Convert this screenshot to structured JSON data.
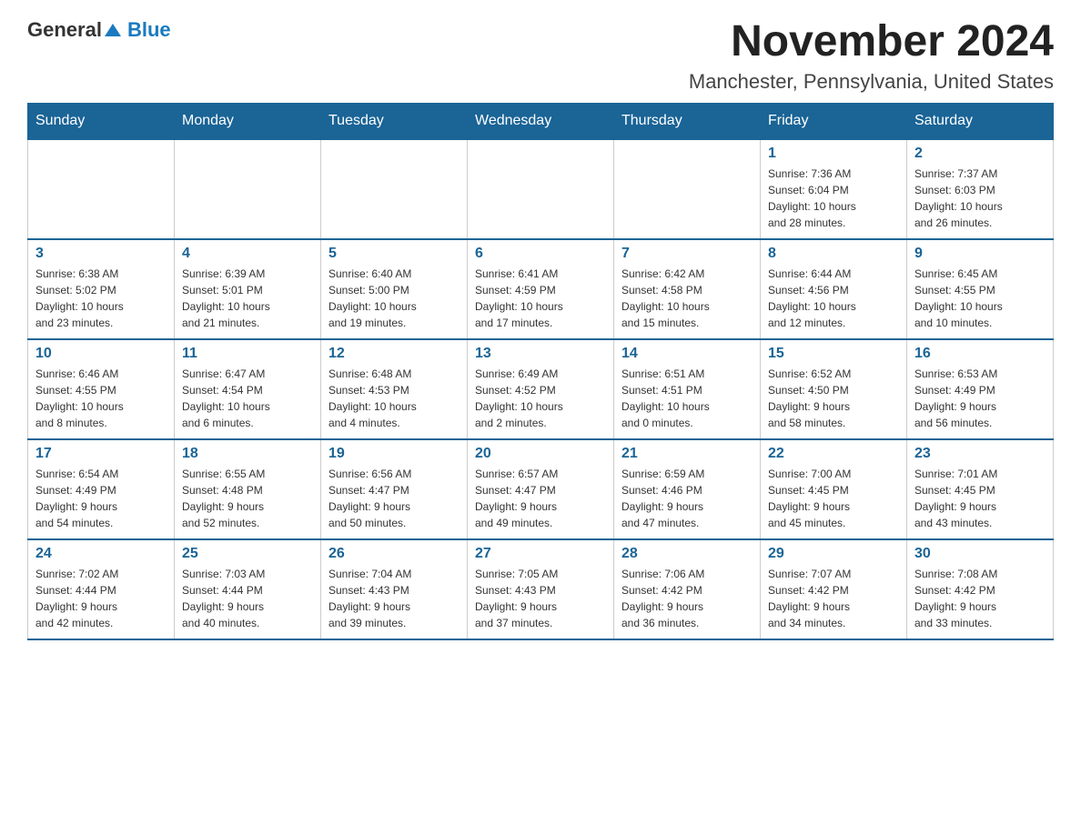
{
  "header": {
    "logo_general": "General",
    "logo_blue": "Blue",
    "month_title": "November 2024",
    "location": "Manchester, Pennsylvania, United States"
  },
  "weekdays": [
    "Sunday",
    "Monday",
    "Tuesday",
    "Wednesday",
    "Thursday",
    "Friday",
    "Saturday"
  ],
  "weeks": [
    [
      {
        "day": "",
        "info": ""
      },
      {
        "day": "",
        "info": ""
      },
      {
        "day": "",
        "info": ""
      },
      {
        "day": "",
        "info": ""
      },
      {
        "day": "",
        "info": ""
      },
      {
        "day": "1",
        "info": "Sunrise: 7:36 AM\nSunset: 6:04 PM\nDaylight: 10 hours\nand 28 minutes."
      },
      {
        "day": "2",
        "info": "Sunrise: 7:37 AM\nSunset: 6:03 PM\nDaylight: 10 hours\nand 26 minutes."
      }
    ],
    [
      {
        "day": "3",
        "info": "Sunrise: 6:38 AM\nSunset: 5:02 PM\nDaylight: 10 hours\nand 23 minutes."
      },
      {
        "day": "4",
        "info": "Sunrise: 6:39 AM\nSunset: 5:01 PM\nDaylight: 10 hours\nand 21 minutes."
      },
      {
        "day": "5",
        "info": "Sunrise: 6:40 AM\nSunset: 5:00 PM\nDaylight: 10 hours\nand 19 minutes."
      },
      {
        "day": "6",
        "info": "Sunrise: 6:41 AM\nSunset: 4:59 PM\nDaylight: 10 hours\nand 17 minutes."
      },
      {
        "day": "7",
        "info": "Sunrise: 6:42 AM\nSunset: 4:58 PM\nDaylight: 10 hours\nand 15 minutes."
      },
      {
        "day": "8",
        "info": "Sunrise: 6:44 AM\nSunset: 4:56 PM\nDaylight: 10 hours\nand 12 minutes."
      },
      {
        "day": "9",
        "info": "Sunrise: 6:45 AM\nSunset: 4:55 PM\nDaylight: 10 hours\nand 10 minutes."
      }
    ],
    [
      {
        "day": "10",
        "info": "Sunrise: 6:46 AM\nSunset: 4:55 PM\nDaylight: 10 hours\nand 8 minutes."
      },
      {
        "day": "11",
        "info": "Sunrise: 6:47 AM\nSunset: 4:54 PM\nDaylight: 10 hours\nand 6 minutes."
      },
      {
        "day": "12",
        "info": "Sunrise: 6:48 AM\nSunset: 4:53 PM\nDaylight: 10 hours\nand 4 minutes."
      },
      {
        "day": "13",
        "info": "Sunrise: 6:49 AM\nSunset: 4:52 PM\nDaylight: 10 hours\nand 2 minutes."
      },
      {
        "day": "14",
        "info": "Sunrise: 6:51 AM\nSunset: 4:51 PM\nDaylight: 10 hours\nand 0 minutes."
      },
      {
        "day": "15",
        "info": "Sunrise: 6:52 AM\nSunset: 4:50 PM\nDaylight: 9 hours\nand 58 minutes."
      },
      {
        "day": "16",
        "info": "Sunrise: 6:53 AM\nSunset: 4:49 PM\nDaylight: 9 hours\nand 56 minutes."
      }
    ],
    [
      {
        "day": "17",
        "info": "Sunrise: 6:54 AM\nSunset: 4:49 PM\nDaylight: 9 hours\nand 54 minutes."
      },
      {
        "day": "18",
        "info": "Sunrise: 6:55 AM\nSunset: 4:48 PM\nDaylight: 9 hours\nand 52 minutes."
      },
      {
        "day": "19",
        "info": "Sunrise: 6:56 AM\nSunset: 4:47 PM\nDaylight: 9 hours\nand 50 minutes."
      },
      {
        "day": "20",
        "info": "Sunrise: 6:57 AM\nSunset: 4:47 PM\nDaylight: 9 hours\nand 49 minutes."
      },
      {
        "day": "21",
        "info": "Sunrise: 6:59 AM\nSunset: 4:46 PM\nDaylight: 9 hours\nand 47 minutes."
      },
      {
        "day": "22",
        "info": "Sunrise: 7:00 AM\nSunset: 4:45 PM\nDaylight: 9 hours\nand 45 minutes."
      },
      {
        "day": "23",
        "info": "Sunrise: 7:01 AM\nSunset: 4:45 PM\nDaylight: 9 hours\nand 43 minutes."
      }
    ],
    [
      {
        "day": "24",
        "info": "Sunrise: 7:02 AM\nSunset: 4:44 PM\nDaylight: 9 hours\nand 42 minutes."
      },
      {
        "day": "25",
        "info": "Sunrise: 7:03 AM\nSunset: 4:44 PM\nDaylight: 9 hours\nand 40 minutes."
      },
      {
        "day": "26",
        "info": "Sunrise: 7:04 AM\nSunset: 4:43 PM\nDaylight: 9 hours\nand 39 minutes."
      },
      {
        "day": "27",
        "info": "Sunrise: 7:05 AM\nSunset: 4:43 PM\nDaylight: 9 hours\nand 37 minutes."
      },
      {
        "day": "28",
        "info": "Sunrise: 7:06 AM\nSunset: 4:42 PM\nDaylight: 9 hours\nand 36 minutes."
      },
      {
        "day": "29",
        "info": "Sunrise: 7:07 AM\nSunset: 4:42 PM\nDaylight: 9 hours\nand 34 minutes."
      },
      {
        "day": "30",
        "info": "Sunrise: 7:08 AM\nSunset: 4:42 PM\nDaylight: 9 hours\nand 33 minutes."
      }
    ]
  ]
}
